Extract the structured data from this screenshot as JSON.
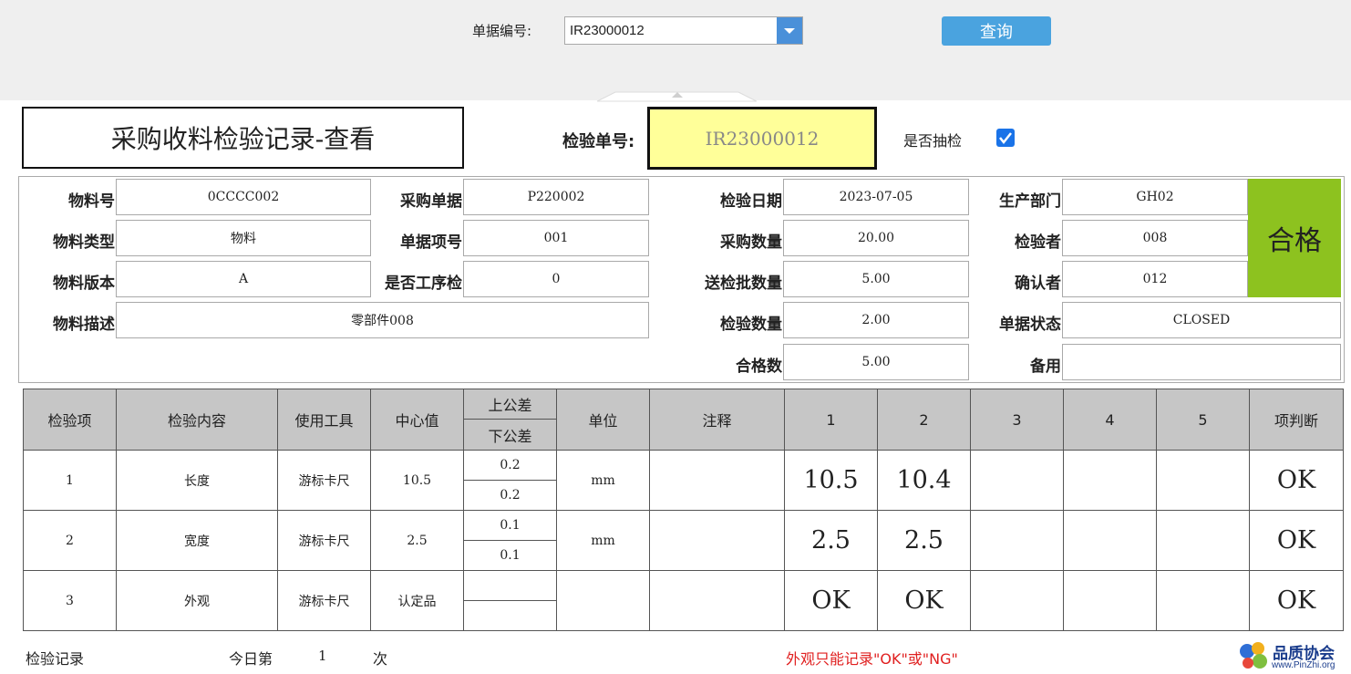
{
  "search": {
    "label": "单据编号:",
    "value": "IR23000012",
    "button": "查询"
  },
  "form": {
    "title": "采购收料检验记录-查看",
    "inspection_no_label": "检验单号:",
    "inspection_no": "IR23000012",
    "sampling_label": "是否抽检",
    "sampling_checked": true,
    "result": "合格",
    "result_color": "#8dc21f",
    "highlight_color": "#ffff99"
  },
  "fields": {
    "material_no": {
      "label": "物料号",
      "value": "0CCCC002"
    },
    "material_type": {
      "label": "物料类型",
      "value": "物料"
    },
    "material_ver": {
      "label": "物料版本",
      "value": "A"
    },
    "material_desc": {
      "label": "物料描述",
      "value": "零部件008"
    },
    "po_no": {
      "label": "采购单据",
      "value": "P220002"
    },
    "po_item": {
      "label": "单据项号",
      "value": "001"
    },
    "process_check": {
      "label": "是否工序检",
      "value": "0"
    },
    "insp_date": {
      "label": "检验日期",
      "value": "2023-07-05"
    },
    "po_qty": {
      "label": "采购数量",
      "value": "20.00"
    },
    "lot_qty": {
      "label": "送检批数量",
      "value": "5.00"
    },
    "insp_qty": {
      "label": "检验数量",
      "value": "2.00"
    },
    "pass_qty": {
      "label": "合格数",
      "value": "5.00"
    },
    "dept": {
      "label": "生产部门",
      "value": "GH02"
    },
    "inspector": {
      "label": "检验者",
      "value": "008"
    },
    "confirmer": {
      "label": "确认者",
      "value": "012"
    },
    "doc_status": {
      "label": "单据状态",
      "value": "CLOSED"
    },
    "spare": {
      "label": "备用",
      "value": ""
    }
  },
  "table": {
    "headers": {
      "item": "检验项",
      "content": "检验内容",
      "tool": "使用工具",
      "center": "中心值",
      "upper": "上公差",
      "lower": "下公差",
      "unit": "单位",
      "note": "注释",
      "c1": "1",
      "c2": "2",
      "c3": "3",
      "c4": "4",
      "c5": "5",
      "judge": "项判断"
    },
    "rows": [
      {
        "item": "1",
        "content": "长度",
        "tool": "游标卡尺",
        "center": "10.5",
        "upper": "0.2",
        "lower": "0.2",
        "unit": "mm",
        "note": "",
        "m1": "10.5",
        "m2": "10.4",
        "m3": "",
        "m4": "",
        "m5": "",
        "judge": "OK"
      },
      {
        "item": "2",
        "content": "宽度",
        "tool": "游标卡尺",
        "center": "2.5",
        "upper": "0.1",
        "lower": "0.1",
        "unit": "mm",
        "note": "",
        "m1": "2.5",
        "m2": "2.5",
        "m3": "",
        "m4": "",
        "m5": "",
        "judge": "OK"
      },
      {
        "item": "3",
        "content": "外观",
        "tool": "游标卡尺",
        "center": "认定品",
        "upper": "",
        "lower": "",
        "unit": "",
        "note": "",
        "m1": "OK",
        "m2": "OK",
        "m3": "",
        "m4": "",
        "m5": "",
        "judge": "OK"
      }
    ]
  },
  "footer": {
    "record_label": "检验记录",
    "today_prefix": "今日第",
    "today_count": "1",
    "today_suffix": "次",
    "warning": "外观只能记录\"OK\"或\"NG\"",
    "warning_color": "#e02020",
    "logo_text": "品质协会",
    "logo_url": "www.PinZhi.org"
  }
}
